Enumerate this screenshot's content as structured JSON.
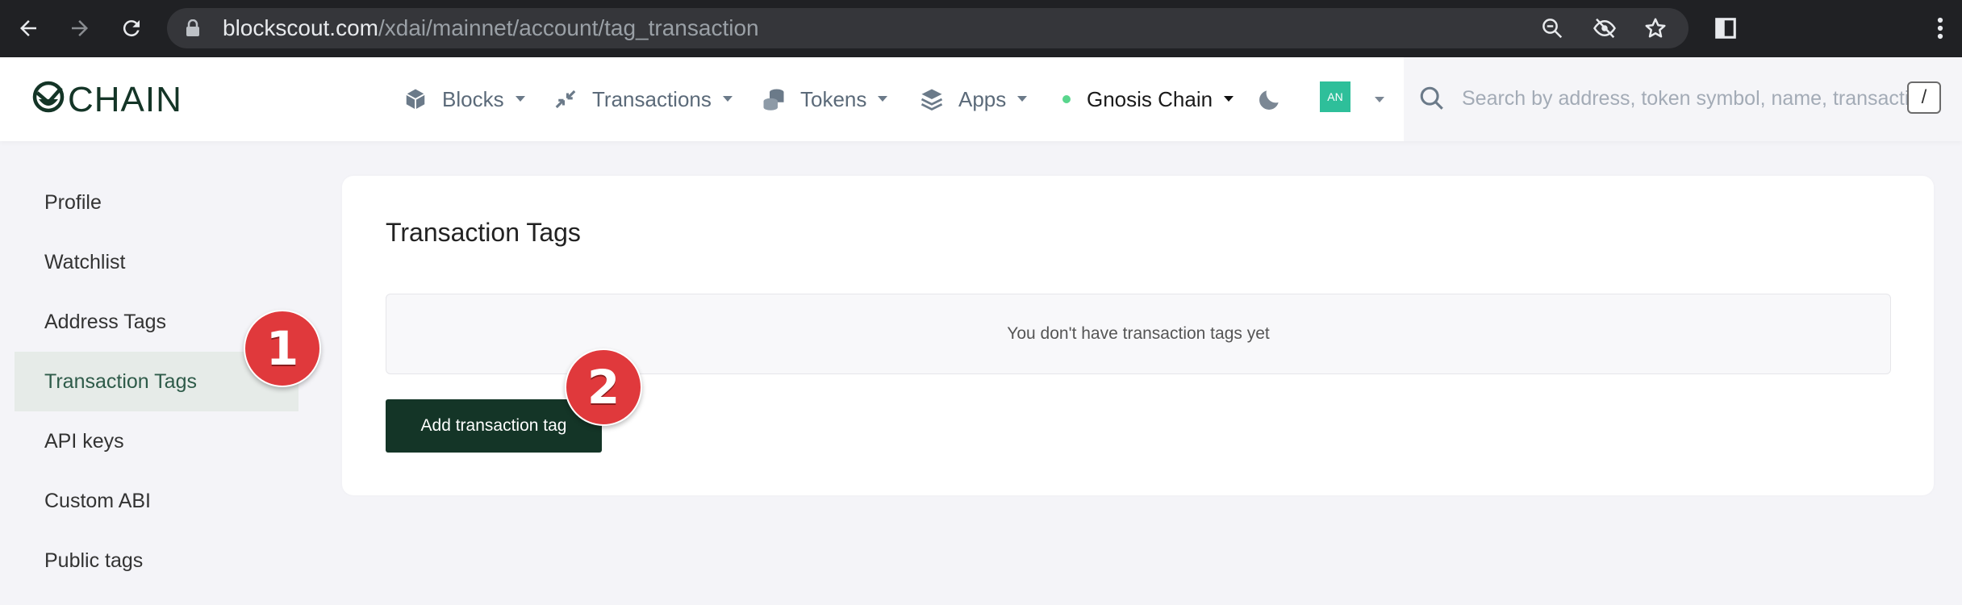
{
  "browser": {
    "url_host": "blockscout.com",
    "url_path": "/xdai/mainnet/account/tag_transaction"
  },
  "header": {
    "logo_text": "CHAIN",
    "nav": [
      {
        "label": "Blocks",
        "icon": "cube-icon"
      },
      {
        "label": "Transactions",
        "icon": "arrows-icon"
      },
      {
        "label": "Tokens",
        "icon": "coins-icon"
      },
      {
        "label": "Apps",
        "icon": "layers-icon"
      }
    ],
    "network": {
      "label": "Gnosis Chain",
      "status_color": "#59d68d"
    },
    "avatar": "AN",
    "search": {
      "placeholder": "Search by address, token symbol, name, transaction hash, or block number",
      "shortcut": "/"
    }
  },
  "sidebar": {
    "items": [
      {
        "label": "Profile"
      },
      {
        "label": "Watchlist"
      },
      {
        "label": "Address Tags"
      },
      {
        "label": "Transaction Tags",
        "active": true
      },
      {
        "label": "API keys"
      },
      {
        "label": "Custom ABI"
      },
      {
        "label": "Public tags"
      }
    ]
  },
  "main": {
    "title": "Transaction Tags",
    "empty_message": "You don't have transaction tags yet",
    "add_button": "Add transaction tag"
  },
  "annotations": {
    "step1": "1",
    "step2": "2",
    "color": "#e0393c"
  }
}
